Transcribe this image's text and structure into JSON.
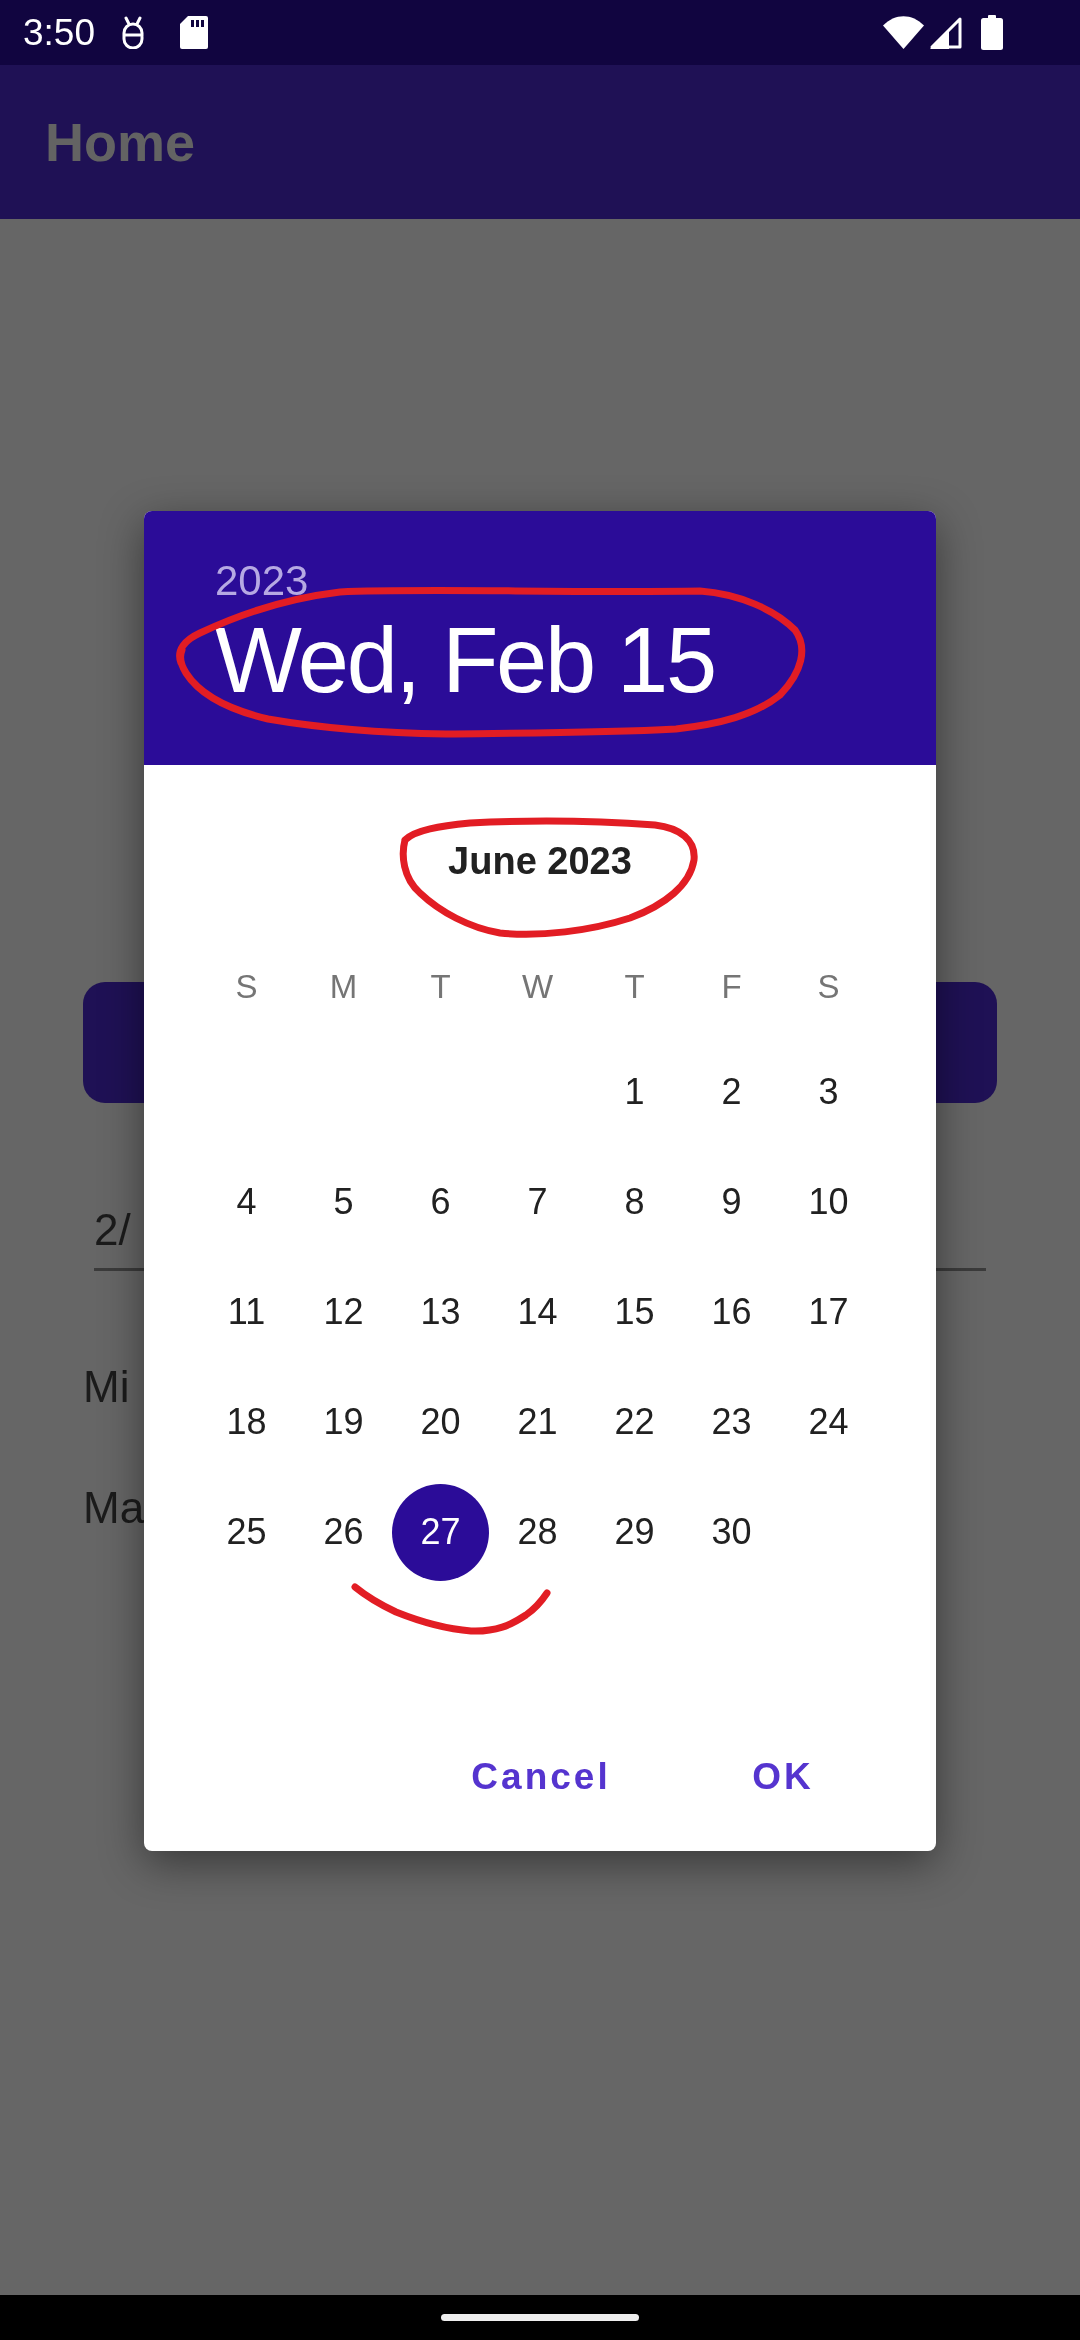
{
  "status_bar": {
    "time": "3:50"
  },
  "app_bar": {
    "title": "Home"
  },
  "background_form": [
    {
      "kind": "button"
    },
    {
      "kind": "field",
      "value": "2/"
    },
    {
      "kind": "label",
      "text": "Mi"
    },
    {
      "kind": "label",
      "text": "Ma"
    }
  ],
  "date_picker": {
    "year": "2023",
    "date": "Wed, Feb 15",
    "date_circled": true,
    "month": "June 2023",
    "month_circled": true,
    "weekdays": [
      "S",
      "M",
      "T",
      "W",
      "T",
      "F",
      "S"
    ],
    "weeks": [
      [
        {
          "label": "1",
          "selected": false,
          "underlined": false
        },
        {
          "label": "2",
          "selected": false,
          "underlined": false
        },
        {
          "label": "3",
          "selected": false,
          "underlined": false
        }
      ],
      [
        {
          "label": "4",
          "selected": false,
          "underlined": false
        },
        {
          "label": "5",
          "selected": false,
          "underlined": false
        },
        {
          "label": "6",
          "selected": false,
          "underlined": false
        },
        {
          "label": "7",
          "selected": false,
          "underlined": false
        },
        {
          "label": "8",
          "selected": false,
          "underlined": false
        },
        {
          "label": "9",
          "selected": false,
          "underlined": false
        },
        {
          "label": "10",
          "selected": false,
          "underlined": false
        }
      ],
      [
        {
          "label": "11",
          "selected": false,
          "underlined": false
        },
        {
          "label": "12",
          "selected": false,
          "underlined": false
        },
        {
          "label": "13",
          "selected": false,
          "underlined": false
        },
        {
          "label": "14",
          "selected": false,
          "underlined": false
        },
        {
          "label": "15",
          "selected": false,
          "underlined": false
        },
        {
          "label": "16",
          "selected": false,
          "underlined": false
        },
        {
          "label": "17",
          "selected": false,
          "underlined": false
        }
      ],
      [
        {
          "label": "18",
          "selected": false,
          "underlined": false
        },
        {
          "label": "19",
          "selected": false,
          "underlined": false
        },
        {
          "label": "20",
          "selected": false,
          "underlined": false
        },
        {
          "label": "21",
          "selected": false,
          "underlined": false
        },
        {
          "label": "22",
          "selected": false,
          "underlined": false
        },
        {
          "label": "23",
          "selected": false,
          "underlined": false
        },
        {
          "label": "24",
          "selected": false,
          "underlined": false
        }
      ],
      [
        {
          "label": "25",
          "selected": false,
          "underlined": false
        },
        {
          "label": "26",
          "selected": false,
          "underlined": false
        },
        {
          "label": "27",
          "selected": true,
          "underlined": true
        },
        {
          "label": "28",
          "selected": false,
          "underlined": false
        },
        {
          "label": "29",
          "selected": false,
          "underlined": false
        },
        {
          "label": "30",
          "selected": false,
          "underlined": false
        }
      ]
    ],
    "buttons": [
      {
        "label": "Cancel"
      },
      {
        "label": "OK"
      }
    ]
  }
}
